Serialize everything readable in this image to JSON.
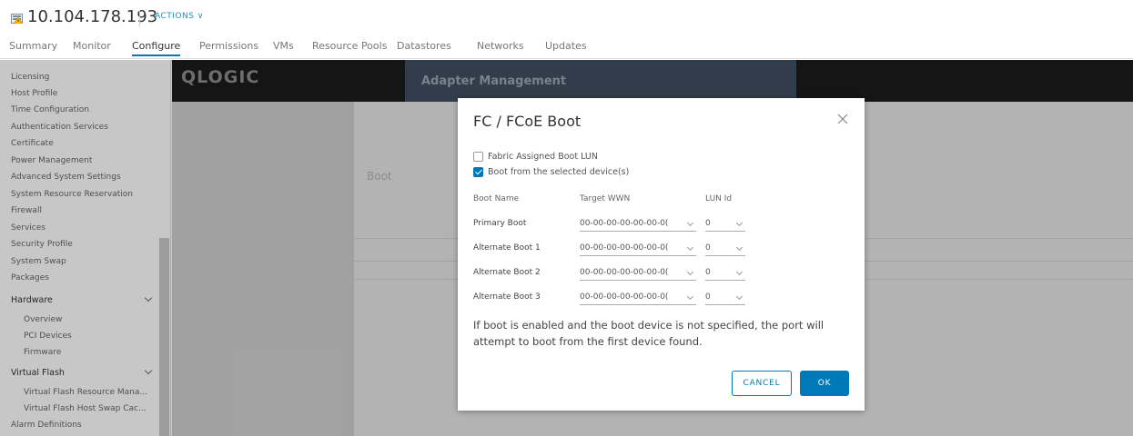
{
  "header": {
    "host": "10.104.178.193",
    "actions": "ACTIONS ∨",
    "tabs": [
      "Summary",
      "Monitor",
      "Configure",
      "Permissions",
      "VMs",
      "Resource Pools",
      "Datastores",
      "Networks",
      "Updates"
    ],
    "active_tab": "Configure"
  },
  "sidebar": {
    "items": [
      "Licensing",
      "Host Profile",
      "Time Configuration",
      "Authentication Services",
      "Certificate",
      "Power Management",
      "Advanced System Settings",
      "System Resource Reservation",
      "Firewall",
      "Services",
      "Security Profile",
      "System Swap",
      "Packages"
    ],
    "hardware": {
      "title": "Hardware",
      "items": [
        "Overview",
        "PCI Devices",
        "Firmware"
      ]
    },
    "virtual_flash": {
      "title": "Virtual Flash",
      "items": [
        "Virtual Flash Resource Mana...",
        "Virtual Flash Host Swap Cac..."
      ]
    },
    "last": "Alarm Definitions"
  },
  "background": {
    "logo": "QLOGIC",
    "adapter_title": "Adapter Management",
    "boot_label": "Boot"
  },
  "modal": {
    "title": "FC / FCoE Boot",
    "checkbox_fabric": "Fabric Assigned Boot LUN",
    "checkbox_fabric_checked": false,
    "checkbox_boot_selected": "Boot from the selected device(s)",
    "checkbox_boot_selected_checked": true,
    "columns": {
      "name": "Boot Name",
      "wwn": "Target WWN",
      "lun": "LUN Id"
    },
    "rows": [
      {
        "name": "Primary Boot",
        "wwn": "00-00-00-00-00-00-0(",
        "lun": "0"
      },
      {
        "name": "Alternate Boot 1",
        "wwn": "00-00-00-00-00-00-0(",
        "lun": "0"
      },
      {
        "name": "Alternate Boot 2",
        "wwn": "00-00-00-00-00-00-0(",
        "lun": "0"
      },
      {
        "name": "Alternate Boot 3",
        "wwn": "00-00-00-00-00-00-0(",
        "lun": "0"
      }
    ],
    "note": "If boot is enabled and the boot device is not specified, the port will attempt to boot from the first device found.",
    "cancel": "CANCEL",
    "ok": "OK"
  }
}
